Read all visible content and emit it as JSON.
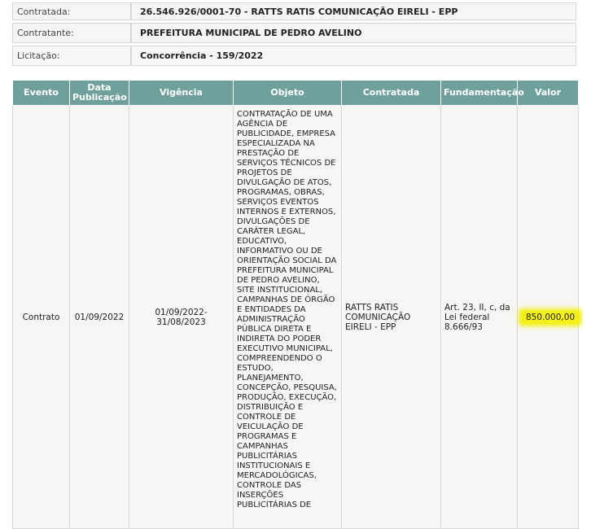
{
  "info": {
    "rows": [
      {
        "label": "Contratada:",
        "value": "26.546.926/0001-70 - RATTS RATIS COMUNICAÇÃO EIRELI - EPP"
      },
      {
        "label": "Contratante:",
        "value": "PREFEITURA MUNICIPAL DE PEDRO AVELINO"
      },
      {
        "label": "Licitação:",
        "value": "Concorrência - 159/2022"
      }
    ]
  },
  "table": {
    "headers": [
      "Evento",
      "Data Publicação",
      "Vigência",
      "Objeto",
      "Contratada",
      "Fundamentação",
      "Valor"
    ],
    "row": {
      "evento": "Contrato",
      "data_publicacao": "01/09/2022",
      "vigencia": "01/09/2022-31/08/2023",
      "objeto": "CONTRATAÇÃO DE UMA AGÊNCIA DE PUBLICIDADE, EMPRESA ESPECIALIZADA NA PRESTAÇÃO DE SERVIÇOS TÉCNICOS DE PROJETOS DE DIVULGAÇÃO DE ATOS, PROGRAMAS, OBRAS, SERVIÇOS EVENTOS INTERNOS E EXTERNOS, DIVULGAÇÕES DE CARÁTER LEGAL, EDUCATIVO, INFORMATIVO OU DE ORIENTAÇÃO SOCIAL DA PREFEITURA MUNICIPAL DE PEDRO AVELINO, SITE INSTITUCIONAL, CAMPANHAS DE ÓRGÃO E ENTIDADES DA ADMINISTRAÇÃO PÚBLICA DIRETA E INDIRETA DO PODER EXECUTIVO MUNICIPAL, COMPREENDENDO O ESTUDO, PLANEJAMENTO, CONCEPÇÃO, PESQUISA, PRODUÇÃO, EXECUÇÃO, DISTRIBUIÇÃO E CONTROLE DE VEICULAÇÃO DE PROGRAMAS E CAMPANHAS PUBLICITÁRIAS INSTITUCIONAIS E MERCADOLÓGICAS, CONTROLE DAS INSERÇÕES PUBLICITÁRIAS DE",
      "contratada": "RATTS RATIS COMUNICAÇÃO EIRELI - EPP",
      "fundamentacao": "Art. 23, II, c, da Lei federal 8.666/93",
      "valor": "850.000,00"
    }
  },
  "colors": {
    "header_bg": "#6fa09b",
    "cell_bg": "#f7f6f4",
    "highlight": "#f3f01c"
  }
}
